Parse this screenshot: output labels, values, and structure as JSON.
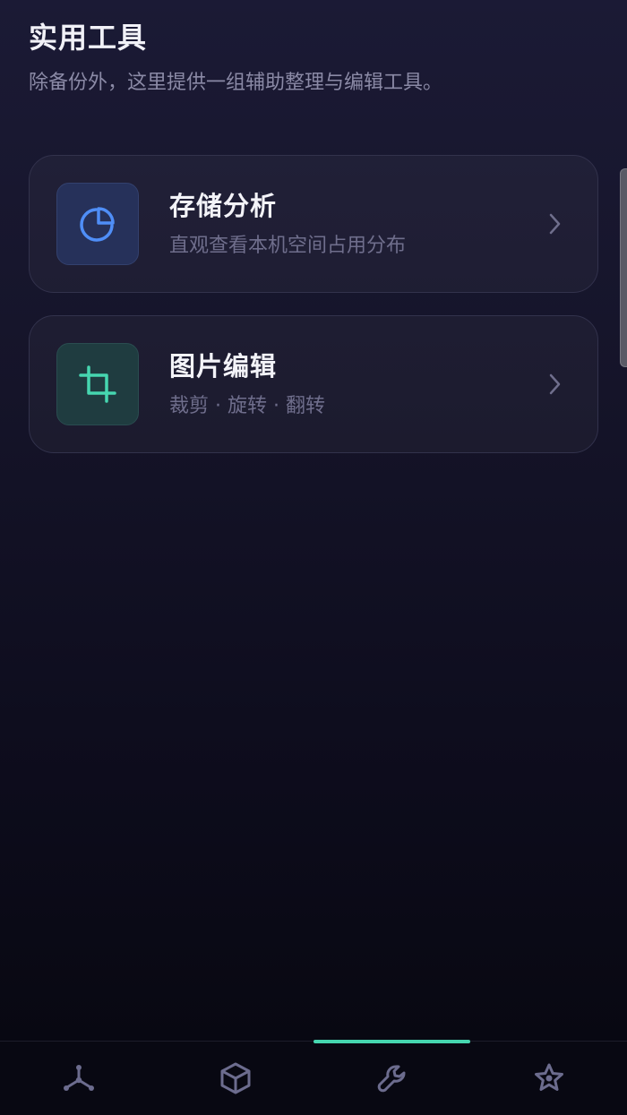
{
  "header": {
    "title": "实用工具",
    "subtitle": "除备份外，这里提供一组辅助整理与编辑工具。"
  },
  "tools": [
    {
      "title": "存储分析",
      "description": "直观查看本机空间占用分布",
      "icon": "pie-chart-icon",
      "accent_color": "#4f8ef7"
    },
    {
      "title": "图片编辑",
      "description": "裁剪 · 旋转 · 翻转",
      "icon": "crop-icon",
      "accent_color": "#46d6b0"
    }
  ],
  "bottom_nav": {
    "items": [
      {
        "icon": "network-icon",
        "active": false
      },
      {
        "icon": "box-icon",
        "active": false
      },
      {
        "icon": "wrench-icon",
        "active": true
      },
      {
        "icon": "star-icon",
        "active": false
      }
    ],
    "active_color": "#46d6b0",
    "inactive_color": "#6c6c8e"
  }
}
